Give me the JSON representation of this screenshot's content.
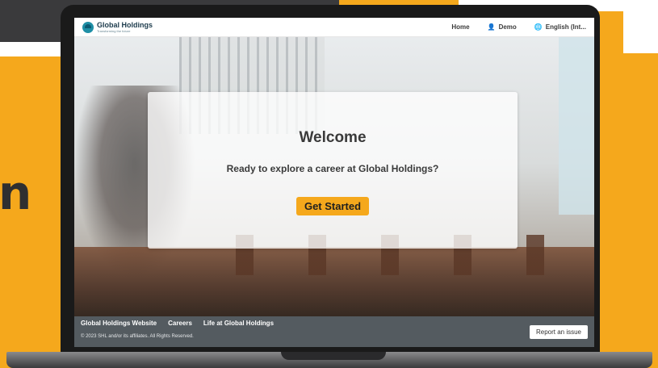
{
  "background": {
    "partial_text": "n",
    "accent_color": "#f5a81c"
  },
  "header": {
    "brand_name": "Global Holdings",
    "brand_tagline": "Transforming the future",
    "nav": [
      {
        "label": "Home",
        "icon": ""
      },
      {
        "label": "Demo",
        "icon": "user-icon"
      },
      {
        "label": "English (Int...",
        "icon": "globe-icon"
      }
    ]
  },
  "hero": {
    "title": "Welcome",
    "subtitle": "Ready to explore a career at Global Holdings?",
    "cta_label": "Get Started"
  },
  "footer": {
    "links": [
      "Global Holdings Website",
      "Careers",
      "Life at Global Holdings"
    ],
    "copyright": "© 2023 SHL and/or its affiliates. All Rights Reserved.",
    "report_label": "Report an issue"
  }
}
